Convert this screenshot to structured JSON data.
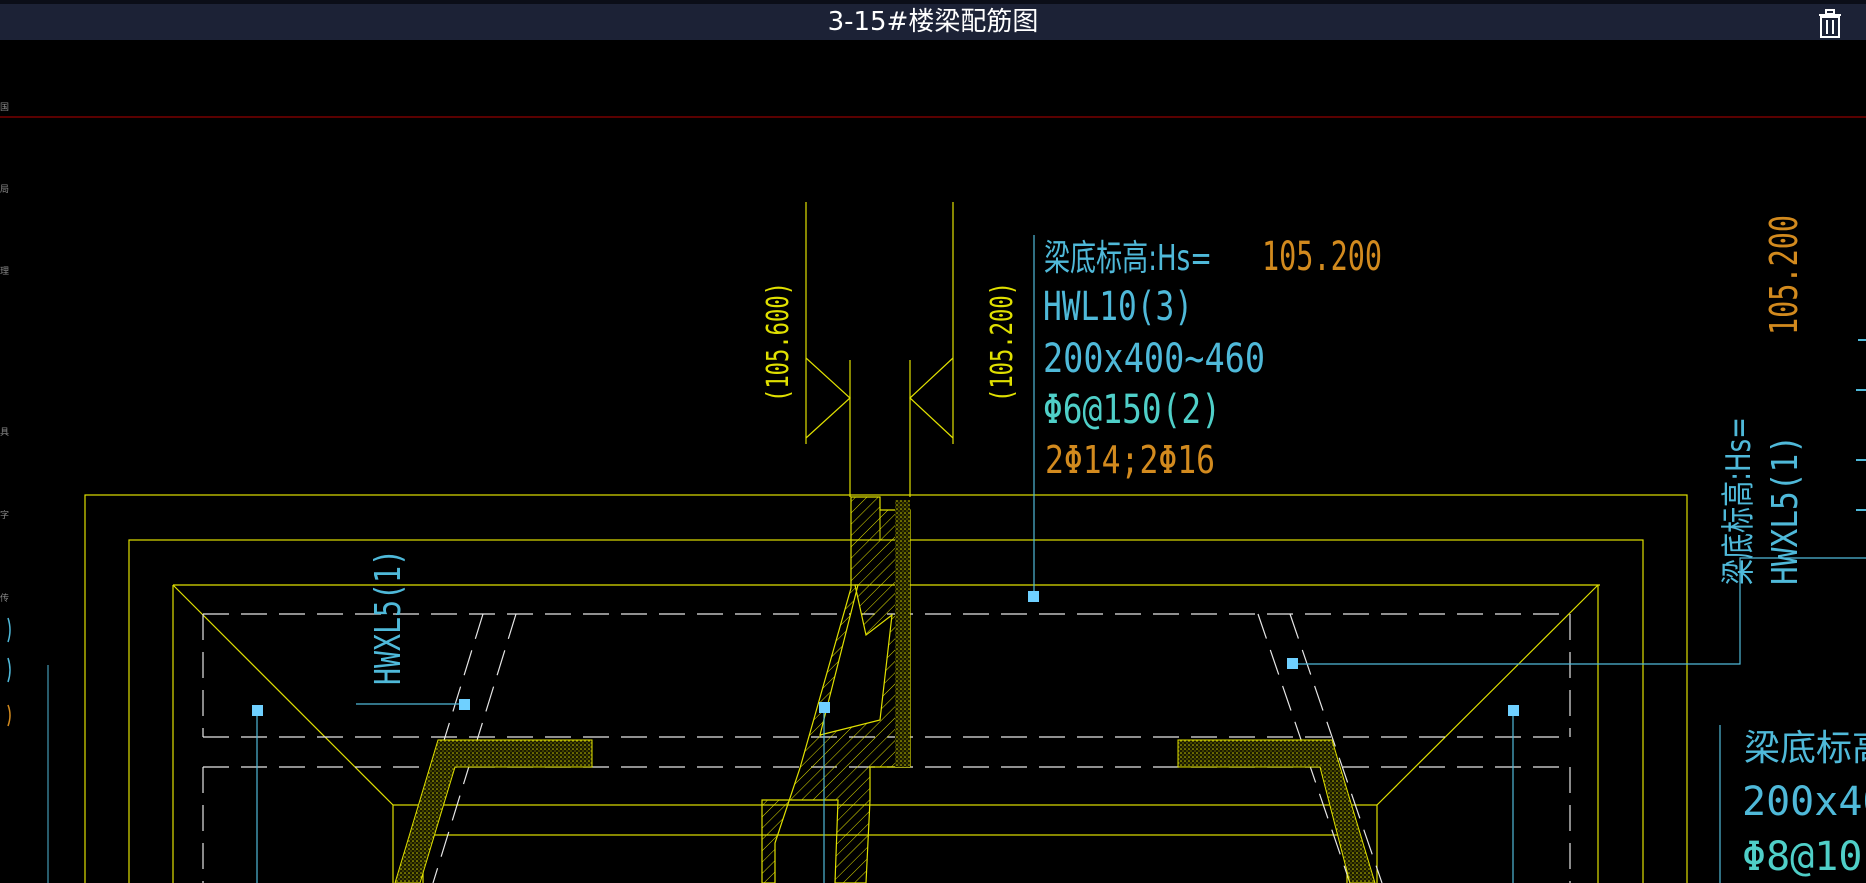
{
  "window": {
    "title": "3-15#楼梁配筋图"
  },
  "icons": {
    "trash": "trash-icon"
  },
  "colors": {
    "background": "#000000",
    "titlebar": "#1c2236",
    "yellow": "#e0e000",
    "cyan": "#4fb9d9",
    "orange": "#d28a1e",
    "red": "#b40000"
  },
  "annotation_hwl10": {
    "label_hs": "梁底标高:Hs=",
    "hs_value": "105.200",
    "beam_id": "HWL10(3)",
    "section": "200x400~460",
    "stirrup": "Φ6@150(2)",
    "bars": "2Φ14;2Φ16"
  },
  "elevations": {
    "left": "(105.600)",
    "right": "(105.200)"
  },
  "annotation_hwxl5_left": {
    "beam_id": "HWXL5(1)"
  },
  "annotation_right_vertical": {
    "hs_value": "105.200",
    "label_hs": "梁底标高:Hs=",
    "beam_id": "HWXL5(1)"
  },
  "annotation_bottom_right": {
    "label_hs": "梁底标高:H",
    "section": "200x40",
    "stirrup": "Φ8@10"
  }
}
